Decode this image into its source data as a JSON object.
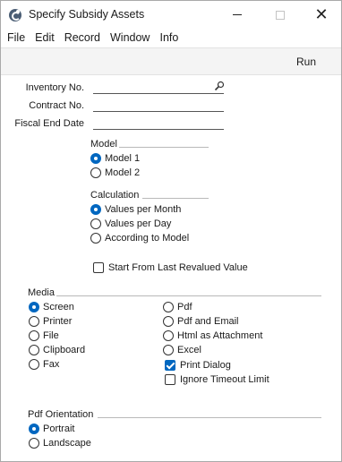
{
  "window": {
    "title": "Specify Subsidy Assets",
    "controls": {
      "minimize": "minimize-icon",
      "maximize": "maximize-icon",
      "close": "close-icon"
    }
  },
  "menubar": {
    "items": [
      "File",
      "Edit",
      "Record",
      "Window",
      "Info"
    ]
  },
  "toolbar": {
    "run_label": "Run"
  },
  "fields": {
    "inventory_no": {
      "label": "Inventory No.",
      "value": ""
    },
    "contract_no": {
      "label": "Contract No.",
      "value": ""
    },
    "fiscal_end_date": {
      "label": "Fiscal End Date",
      "value": ""
    }
  },
  "model": {
    "title": "Model",
    "options": [
      {
        "label": "Model 1",
        "selected": true
      },
      {
        "label": "Model 2",
        "selected": false
      }
    ]
  },
  "calculation": {
    "title": "Calculation",
    "options": [
      {
        "label": "Values per Month",
        "selected": true
      },
      {
        "label": "Values per Day",
        "selected": false
      },
      {
        "label": "According to Model",
        "selected": false
      }
    ]
  },
  "start_from_last": {
    "label": "Start From Last Revalued Value",
    "checked": false
  },
  "media": {
    "title": "Media",
    "left_options": [
      {
        "label": "Screen",
        "selected": true
      },
      {
        "label": "Printer",
        "selected": false
      },
      {
        "label": "File",
        "selected": false
      },
      {
        "label": "Clipboard",
        "selected": false
      },
      {
        "label": "Fax",
        "selected": false
      }
    ],
    "right_options": [
      {
        "label": "Pdf",
        "selected": false
      },
      {
        "label": "Pdf and Email",
        "selected": false
      },
      {
        "label": "Html as Attachment",
        "selected": false
      },
      {
        "label": "Excel",
        "selected": false
      }
    ],
    "print_dialog": {
      "label": "Print Dialog",
      "checked": true
    },
    "ignore_timeout": {
      "label": "Ignore Timeout Limit",
      "checked": false
    }
  },
  "pdf_orientation": {
    "title": "Pdf Orientation",
    "options": [
      {
        "label": "Portrait",
        "selected": true
      },
      {
        "label": "Landscape",
        "selected": false
      }
    ]
  },
  "colors": {
    "accent": "#0067c0",
    "toolbar_bg": "#f4f4f4"
  }
}
